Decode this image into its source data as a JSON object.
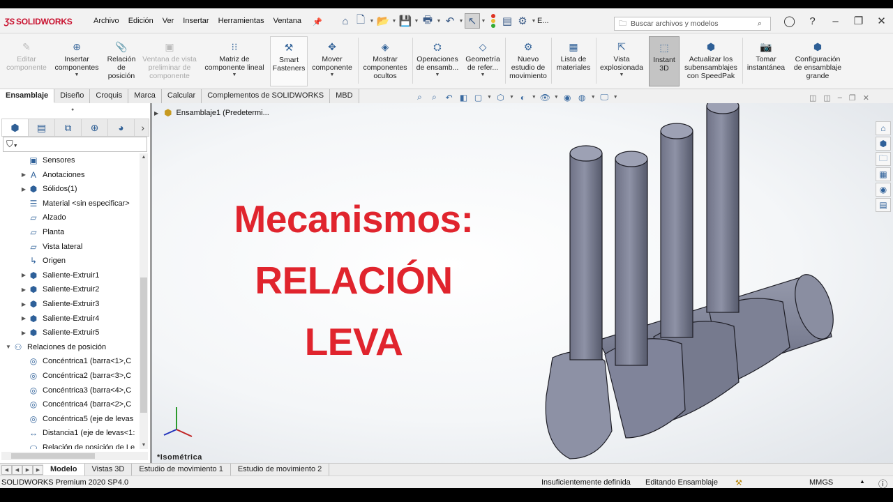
{
  "app": {
    "logo_text": "SOLIDWORKS",
    "menu": [
      "Archivo",
      "Edición",
      "Ver",
      "Insertar",
      "Herramientas",
      "Ventana"
    ],
    "search_placeholder": "Buscar archivos y modelos",
    "overflow_label": "E..."
  },
  "ribbon": {
    "buttons": [
      {
        "label": "Editar\ncomponente",
        "disabled": true
      },
      {
        "label": "Insertar\ncomponentes"
      },
      {
        "label": "Relación\nde\nposición"
      },
      {
        "label": "Ventana de vista\npreliminar de\ncomponente",
        "disabled": true
      },
      {
        "label": "Matriz de\ncomponente lineal"
      },
      {
        "label": "Smart\nFasteners"
      },
      {
        "label": "Mover\ncomponente"
      },
      {
        "label": "Mostrar\ncomponentes\nocultos"
      },
      {
        "label": "Operaciones\nde ensamb..."
      },
      {
        "label": "Geometría\nde refer..."
      },
      {
        "label": "Nuevo\nestudio de\nmovimiento"
      },
      {
        "label": "Lista de\nmateriales"
      },
      {
        "label": "Vista\nexplosionada"
      },
      {
        "label": "Instant\n3D",
        "active": true
      },
      {
        "label": "Actualizar los\nsubensamblajes\ncon SpeedPak"
      },
      {
        "label": "Tomar\ninstantánea"
      },
      {
        "label": "Configuración\nde ensamblaje\ngrande"
      }
    ]
  },
  "tabs": [
    "Ensamblaje",
    "Diseño",
    "Croquis",
    "Marca",
    "Calcular",
    "Complementos de SOLIDWORKS",
    "MBD"
  ],
  "feature_tree": {
    "items": [
      {
        "label": "Sensores",
        "icon": "sensor-icon"
      },
      {
        "label": "Anotaciones",
        "icon": "annotation-icon",
        "expandable": true
      },
      {
        "label": "Sólidos(1)",
        "icon": "solid-bodies-icon",
        "expandable": true
      },
      {
        "label": "Material <sin especificar>",
        "icon": "material-icon"
      },
      {
        "label": "Alzado",
        "icon": "plane-icon"
      },
      {
        "label": "Planta",
        "icon": "plane-icon"
      },
      {
        "label": "Vista lateral",
        "icon": "plane-icon"
      },
      {
        "label": "Origen",
        "icon": "origin-icon"
      },
      {
        "label": "Saliente-Extruir1",
        "icon": "extrude-icon",
        "expandable": true
      },
      {
        "label": "Saliente-Extruir2",
        "icon": "extrude-icon",
        "expandable": true
      },
      {
        "label": "Saliente-Extruir3",
        "icon": "extrude-icon",
        "expandable": true
      },
      {
        "label": "Saliente-Extruir4",
        "icon": "extrude-icon",
        "expandable": true
      },
      {
        "label": "Saliente-Extruir5",
        "icon": "extrude-icon",
        "expandable": true
      },
      {
        "label": "Relaciones de posición",
        "icon": "mates-folder-icon",
        "expanded": true
      },
      {
        "label": "Concéntrica1 (barra<1>,C",
        "icon": "concentric-icon"
      },
      {
        "label": "Concéntrica2 (barra<3>,C",
        "icon": "concentric-icon"
      },
      {
        "label": "Concéntrica3 (barra<4>,C",
        "icon": "concentric-icon"
      },
      {
        "label": "Concéntrica4 (barra<2>,C",
        "icon": "concentric-icon"
      },
      {
        "label": "Concéntrica5 (eje de levas",
        "icon": "concentric-icon"
      },
      {
        "label": "Distancia1 (eje de levas<1:",
        "icon": "distance-icon"
      },
      {
        "label": "Relación de posición de Le",
        "icon": "cam-mate-icon"
      }
    ]
  },
  "viewport": {
    "breadcrumb": "Ensamblaje1  (Predetermi...",
    "headline": [
      "Mecanismos:",
      "RELACIÓN",
      "LEVA"
    ],
    "view_name": "*Isométrica",
    "headline_color": "#e0242d"
  },
  "bottom_tabs": [
    "Modelo",
    "Vistas 3D",
    "Estudio de movimiento 1",
    "Estudio de movimiento 2"
  ],
  "status": {
    "version": "SOLIDWORKS Premium 2020 SP4.0",
    "definition": "Insuficientemente definida",
    "mode": "Editando Ensamblaje",
    "units": "MMGS"
  }
}
